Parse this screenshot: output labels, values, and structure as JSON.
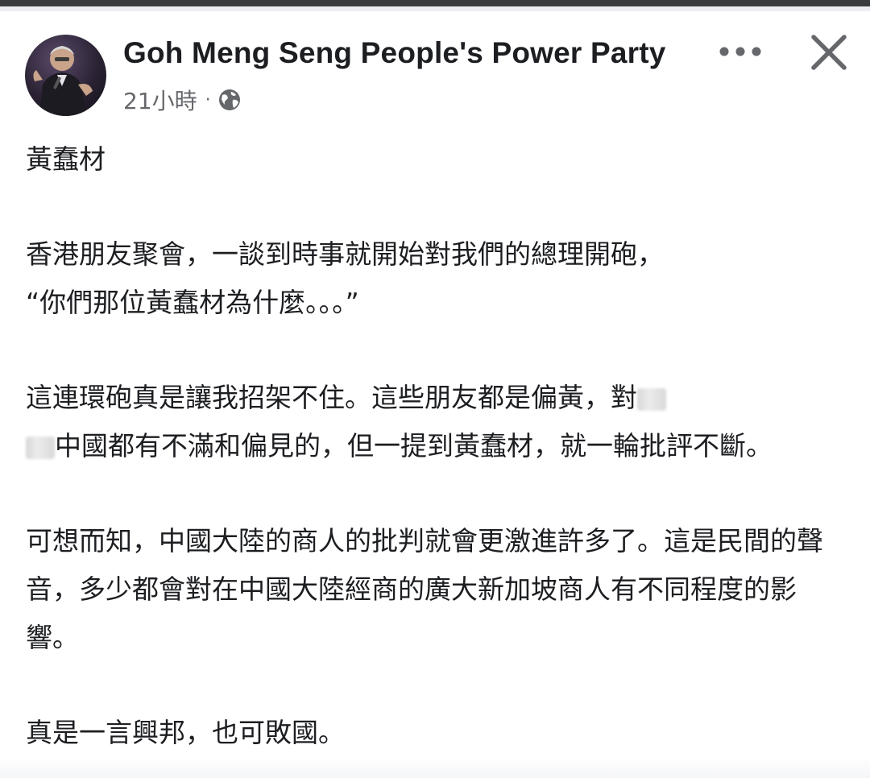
{
  "post": {
    "author": "Goh Meng Seng People's Power Party",
    "time_label": "21小時",
    "separator": "·",
    "privacy_icon": "globe-icon"
  },
  "actions": {
    "more_icon": "more-horizontal-icon",
    "close_icon": "close-icon"
  },
  "content": {
    "p1": "黃蠢材",
    "p2_line1": "香港朋友聚會，一談到時事就開始對我們的",
    "p2_line1b": "總理開砲，",
    "p2_line2": "“你們那位黃蠢材為什麼。。。”",
    "p3_a": "這連環砲真是讓我招架不住。這些朋友都是偏黃，對",
    "p3_b": "中國都有不滿和偏見的，但一提到黃蠢材，就一輪批評不斷。",
    "p4": "可想而知，中國大陸的商人的批判就會更激進許多了。這是民間的聲音，多少都會對在中國大陸經商的廣大新加坡商人有不同程度的影響。",
    "p5": "真是一言興邦，也可敗國。"
  },
  "colors": {
    "text": "#1c1e21",
    "meta": "#65676b",
    "icon": "#65676b",
    "background": "#ffffff"
  }
}
